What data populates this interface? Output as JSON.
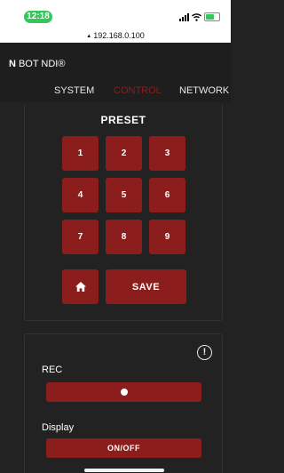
{
  "status_bar": {
    "time": "12:18",
    "url": "192.168.0.100"
  },
  "header": {
    "brand_mark": "N",
    "title": "BOT NDI®"
  },
  "tabs": [
    {
      "label": "SYSTEM",
      "active": false
    },
    {
      "label": "CONTROL",
      "active": true
    },
    {
      "label": "NETWORK",
      "active": false
    }
  ],
  "preset": {
    "title": "PRESET",
    "buttons": [
      "1",
      "2",
      "3",
      "4",
      "5",
      "6",
      "7",
      "8",
      "9"
    ],
    "home_icon": "home-icon",
    "save_label": "SAVE"
  },
  "record": {
    "info_icon": "info-icon",
    "info_glyph": "!",
    "rec_label": "REC",
    "rec_button_icon": "record-dot-icon",
    "display_label": "Display",
    "display_button_label": "ON/OFF"
  },
  "colors": {
    "accent": "#8c1d1d",
    "background": "#222222",
    "header": "#1e1e1e",
    "status_pill": "#34c759"
  }
}
